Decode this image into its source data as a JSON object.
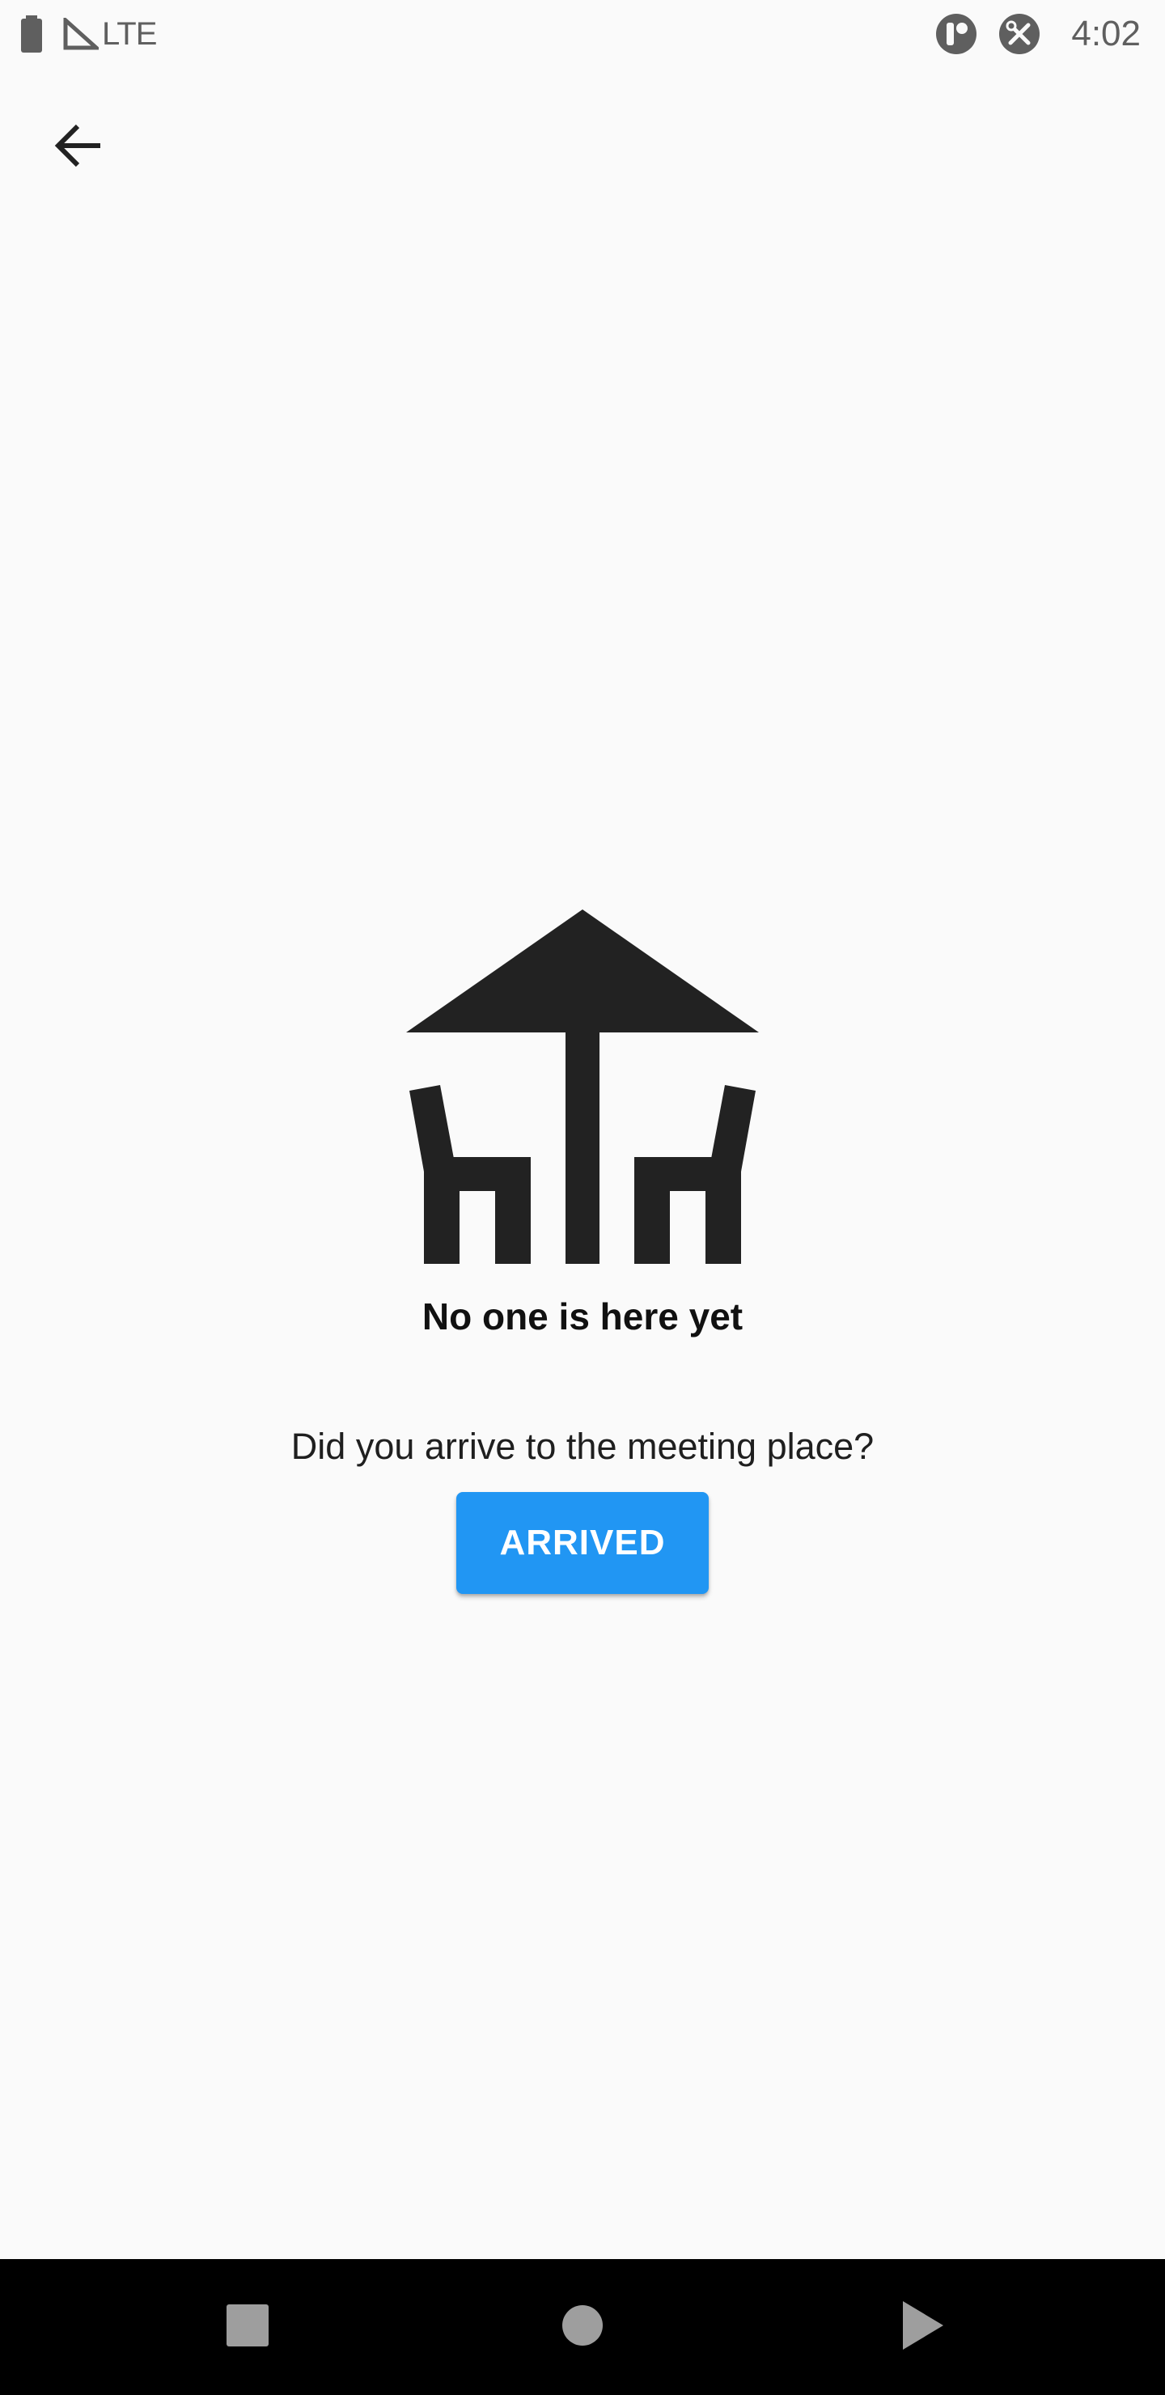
{
  "status_bar": {
    "network": "LTE",
    "time": "4:02",
    "icons": [
      "battery-icon",
      "signal-icon",
      "notification-app-icon",
      "developer-tools-icon"
    ]
  },
  "app_bar": {
    "back_icon": "arrow-back-icon"
  },
  "empty_state": {
    "illustration": "outdoor-table-umbrella-icon",
    "title": "No one is here yet",
    "prompt": "Did you arrive to the meeting place?",
    "button_label": "ARRIVED"
  },
  "nav_bar": {
    "icons": [
      "recents-square-icon",
      "home-circle-icon",
      "back-triangle-icon"
    ]
  },
  "colors": {
    "background": "#fafafa",
    "accent": "#2196f3",
    "icon_dark": "#222222",
    "nav_background": "#000000",
    "nav_icons": "#9e9e9e"
  }
}
